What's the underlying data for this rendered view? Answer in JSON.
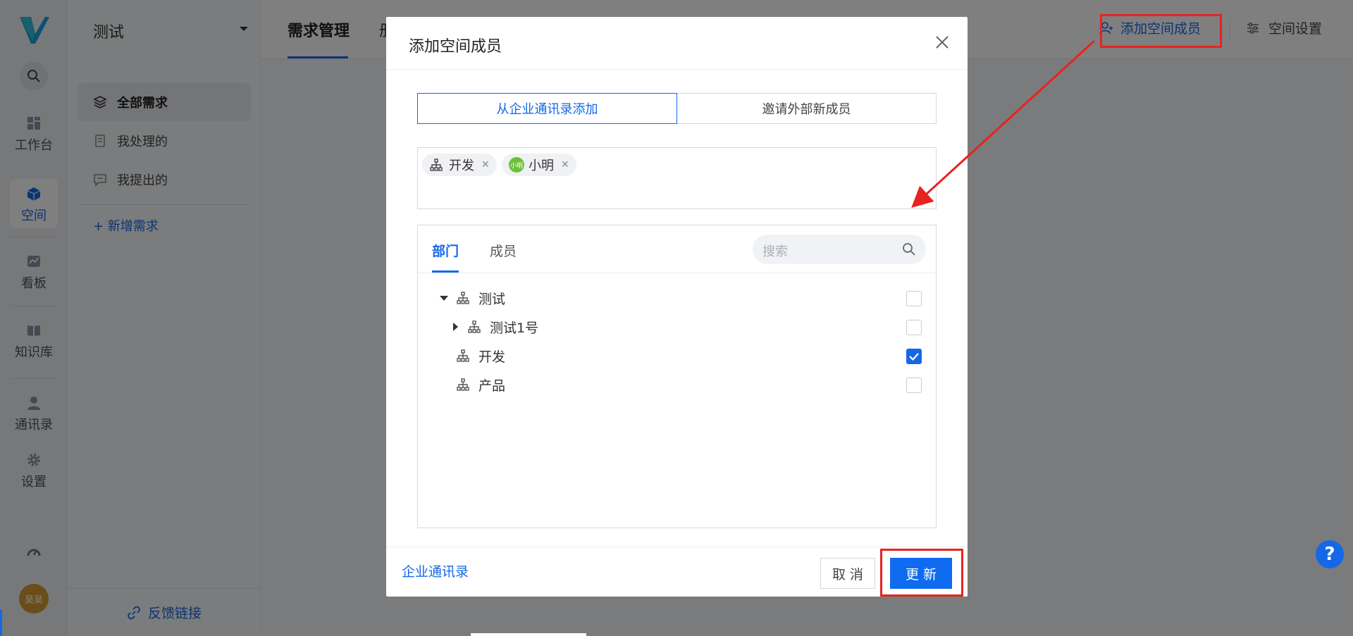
{
  "rail": {
    "items": [
      {
        "label": "工作台",
        "icon": "dashboard-icon"
      },
      {
        "label": "空间",
        "icon": "cube-icon"
      },
      {
        "label": "看板",
        "icon": "chart-icon"
      },
      {
        "label": "知识库",
        "icon": "book-icon"
      },
      {
        "label": "通讯录",
        "icon": "contacts-icon"
      },
      {
        "label": "设置",
        "icon": "gear-icon"
      }
    ],
    "avatar_text": "昊昊"
  },
  "sidebar": {
    "project": "测试",
    "items": [
      {
        "label": "全部需求"
      },
      {
        "label": "我处理的"
      },
      {
        "label": "我提出的"
      }
    ],
    "add_label": "+  新增需求",
    "feedback_label": "反馈链接"
  },
  "topbar": {
    "tab": "需求管理",
    "tab2": "册",
    "add_member": "添加空间成员",
    "settings": "空间设置"
  },
  "modal": {
    "title": "添加空间成员",
    "seg": [
      "从企业通讯录添加",
      "邀请外部新成员"
    ],
    "picked": [
      {
        "label": "开发",
        "type": "department"
      },
      {
        "label": "小明",
        "type": "member",
        "avatar": "小明"
      }
    ],
    "tabs": [
      "部门",
      "成员"
    ],
    "search_placeholder": "搜索",
    "tree": [
      {
        "label": "测试",
        "level": 0,
        "expanded": true,
        "checked": false
      },
      {
        "label": "测试1号",
        "level": 1,
        "expanded": false,
        "checked": false
      },
      {
        "label": "开发",
        "level": 0,
        "checked": true
      },
      {
        "label": "产品",
        "level": 0,
        "checked": false
      }
    ],
    "footer_link": "企业通讯录",
    "cancel": "取 消",
    "ok": "更 新"
  },
  "colors": {
    "accent": "#1468e8",
    "annotation": "#e8231f",
    "avatar_green": "#6bc13a",
    "avatar_gold": "#d59a32"
  }
}
